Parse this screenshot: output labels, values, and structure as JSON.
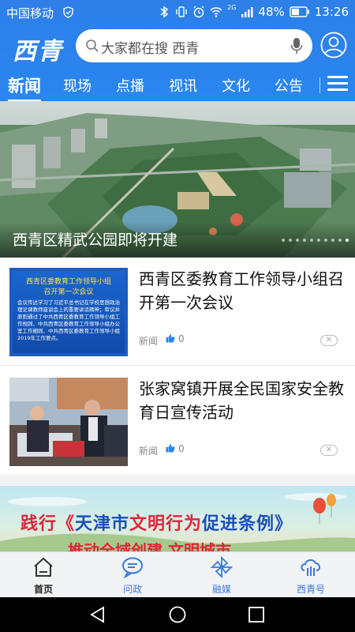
{
  "status_bar": {
    "carrier": "中国移动",
    "network": "2G",
    "battery": "48%",
    "time": "13:26"
  },
  "header": {
    "logo": "西青",
    "search_placeholder": "大家都在搜 西青"
  },
  "tabs": [
    {
      "label": "新闻",
      "active": true
    },
    {
      "label": "现场",
      "active": false
    },
    {
      "label": "点播",
      "active": false
    },
    {
      "label": "视讯",
      "active": false
    },
    {
      "label": "文化",
      "active": false
    },
    {
      "label": "公告",
      "active": false
    }
  ],
  "hero": {
    "title": "西青区精武公园即将开建",
    "slide_count": 10,
    "active_slide": 10
  },
  "news": [
    {
      "title": "西青区委教育工作领导小组召开第一次会议",
      "tag": "新闻",
      "likes": "0",
      "thumb_heading": "西青区委教育工作领导小组\n召开第一次会议",
      "thumb_body": "会议传达学习了习近平总书记在学校思想政治理论课教师座谈会上的重要讲话精神；审议并原则通过了中共西青区委教育工作领导小组工作规则、中共西青区委教育工作领导小组办公室工作细则、中共西青区委教育工作领导小组2019年工作要点。"
    },
    {
      "title": "张家窝镇开展全民国家安全教育日宣传活动",
      "tag": "新闻",
      "likes": "0"
    }
  ],
  "promo": {
    "line1_a": "践行《",
    "line1_b": "天津市",
    "line1_c": "文明行为",
    "line1_d": "促进条例》",
    "line2": "推动全域创建 文明城市"
  },
  "bottom_nav": [
    {
      "label": "首页",
      "icon": "home-icon",
      "active": true
    },
    {
      "label": "问政",
      "icon": "chat-icon",
      "active": false
    },
    {
      "label": "融媒",
      "icon": "pinwheel-icon",
      "active": false
    },
    {
      "label": "西青号",
      "icon": "cloud-icon",
      "active": false
    }
  ],
  "colors": {
    "primary": "#2a86f0",
    "nav_active": "#222222",
    "nav_inactive": "#3a7ad6"
  }
}
